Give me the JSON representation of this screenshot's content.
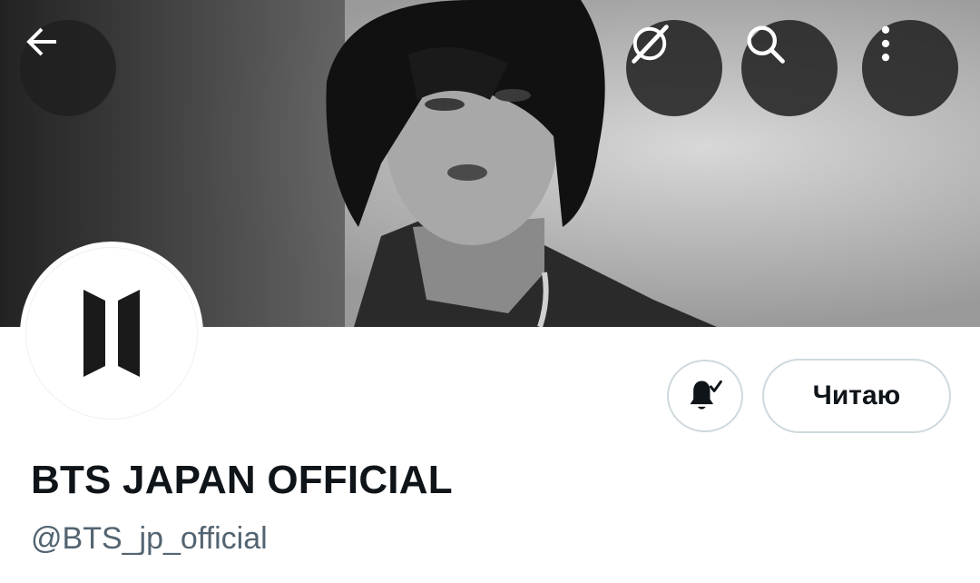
{
  "profile": {
    "display_name": "BTS JAPAN OFFICIAL",
    "handle": "@BTS_jp_official",
    "follow_label": "Читаю"
  },
  "icons": {
    "back": "arrow-left-icon",
    "grok": "grok-icon",
    "search": "search-icon",
    "more": "more-vertical-icon",
    "notifications": "bell-check-icon",
    "avatar_logo": "bts-logo-icon"
  },
  "colors": {
    "text_primary": "#0f1419",
    "text_secondary": "#536471",
    "border": "#cfd9de",
    "overlay_button": "#202020"
  }
}
